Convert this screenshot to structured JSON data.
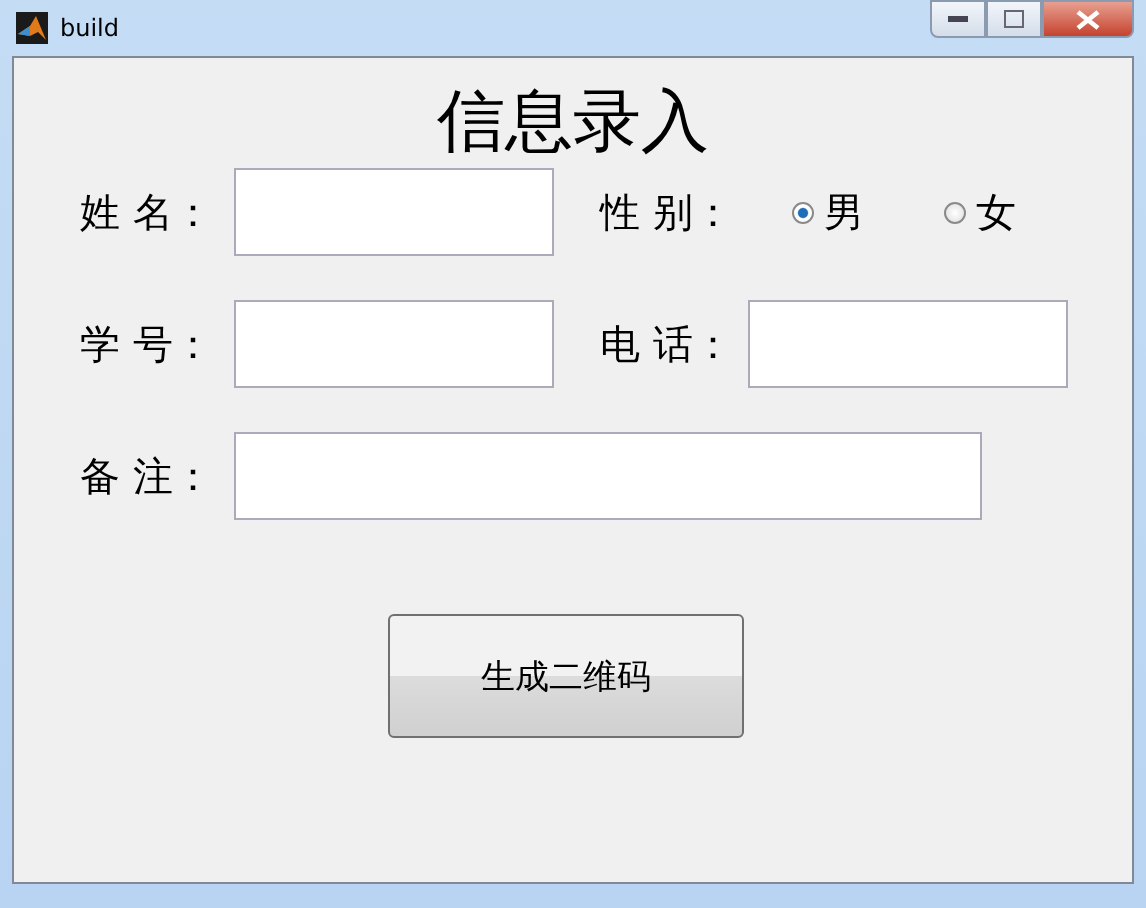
{
  "window": {
    "title": "build"
  },
  "heading": "信息录入",
  "fields": [
    {
      "label": "姓 名：",
      "kind": "input"
    },
    {
      "label": "性 别：",
      "kind": "radio",
      "options": [
        {
          "label": "男",
          "selected": true
        },
        {
          "label": "女",
          "selected": false
        }
      ]
    },
    {
      "label": "学 号：",
      "kind": "input"
    },
    {
      "label": "电 话：",
      "kind": "input"
    },
    {
      "label": "备 注：",
      "kind": "input"
    }
  ],
  "button": "生成二维码"
}
